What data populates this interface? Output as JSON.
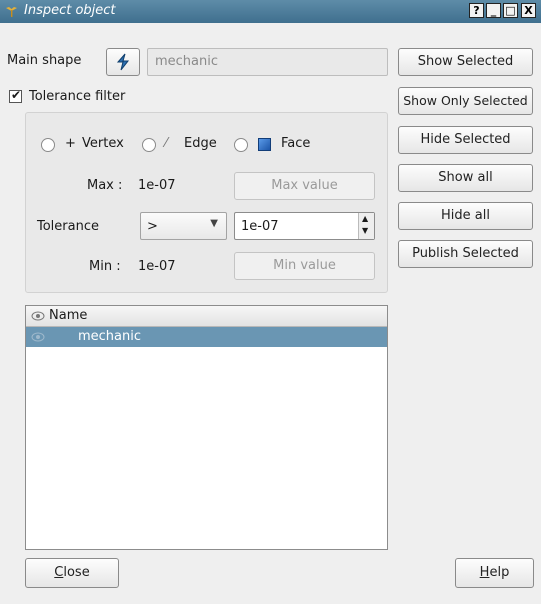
{
  "window": {
    "title": "Inspect object",
    "controls": [
      "?",
      "_",
      "□",
      "X"
    ]
  },
  "main_shape": {
    "label": "Main shape",
    "value": "mechanic"
  },
  "tolerance_filter": {
    "label": "Tolerance filter",
    "checked": true
  },
  "shape_types": [
    {
      "symbol": "+",
      "label": "Vertex"
    },
    {
      "symbol": "⁄",
      "label": "Edge"
    },
    {
      "symbol": "",
      "label": "Face"
    }
  ],
  "max": {
    "label": "Max :",
    "value": "1e-07",
    "button": "Max value"
  },
  "tolerance": {
    "label": "Tolerance",
    "operator": ">",
    "value": "1e-07"
  },
  "min": {
    "label": "Min :",
    "value": "1e-07",
    "button": "Min value"
  },
  "tree": {
    "column": "Name",
    "rows": [
      {
        "name": "mechanic",
        "selected": true
      }
    ]
  },
  "actions": [
    "Show Selected",
    "Show Only Selected",
    "Hide Selected",
    "Show all",
    "Hide all",
    "Publish Selected"
  ],
  "footer": {
    "close_prefix": "",
    "close_mnemonic": "C",
    "close_rest": "lose",
    "help_prefix": "",
    "help_mnemonic": "H",
    "help_rest": "elp"
  },
  "colors": {
    "titlebar": "#4f7f9e",
    "selection": "#6a96b3",
    "face_swatch": "#2a6fd0"
  }
}
